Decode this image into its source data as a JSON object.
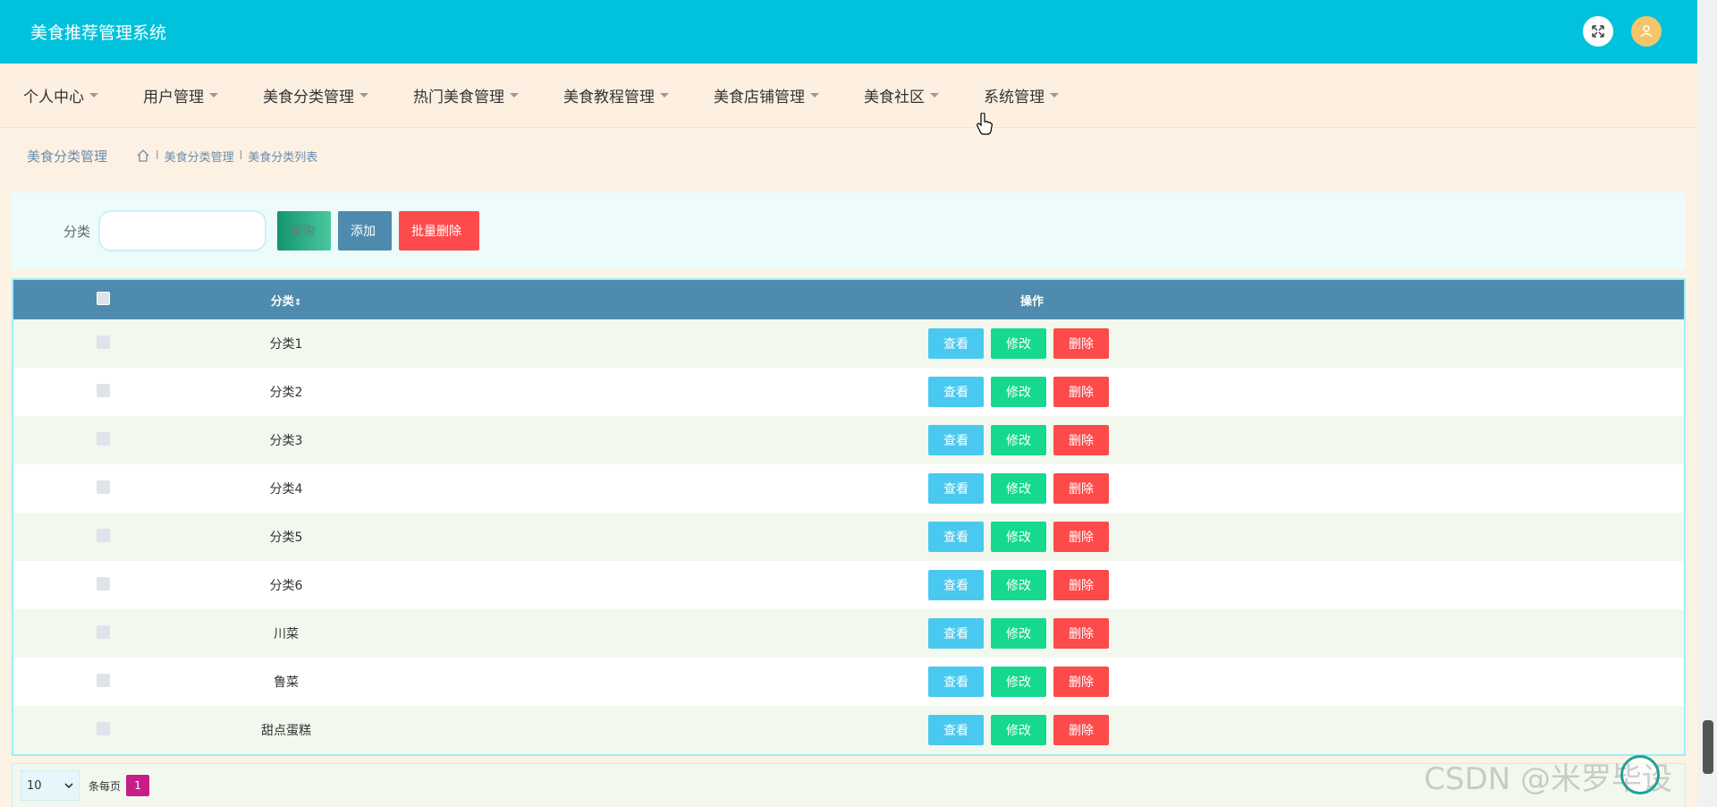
{
  "header": {
    "title": "美食推荐管理系统"
  },
  "nav": {
    "items": [
      {
        "label": "个人中心"
      },
      {
        "label": "用户管理"
      },
      {
        "label": "美食分类管理"
      },
      {
        "label": "热门美食管理"
      },
      {
        "label": "美食教程管理"
      },
      {
        "label": "美食店铺管理"
      },
      {
        "label": "美食社区"
      },
      {
        "label": "系统管理"
      }
    ]
  },
  "breadcrumb": {
    "title": "美食分类管理",
    "path": [
      "美食分类管理",
      "美食分类列表"
    ],
    "separator": "l"
  },
  "search": {
    "label": "分类",
    "value": "",
    "query_label": "查询",
    "add_label": "添加",
    "batch_delete_label": "批量删除"
  },
  "table": {
    "headers": {
      "name": "分类",
      "sort_icon": "⇕",
      "ops": "操作"
    },
    "rows": [
      {
        "name": "分类1"
      },
      {
        "name": "分类2"
      },
      {
        "name": "分类3"
      },
      {
        "name": "分类4"
      },
      {
        "name": "分类5"
      },
      {
        "name": "分类6"
      },
      {
        "name": "川菜"
      },
      {
        "name": "鲁菜"
      },
      {
        "name": "甜点蛋糕"
      }
    ],
    "row_actions": {
      "view": "查看",
      "edit": "修改",
      "delete": "删除"
    }
  },
  "pager": {
    "page_size": "10",
    "per_page_label": "条每页",
    "current_page": "1"
  },
  "watermark": "CSDN @米罗毕设",
  "colors": {
    "header_bg": "#00c2dc",
    "table_head": "#4f8bae",
    "view": "#49c9ef",
    "edit": "#16d98d",
    "delete": "#fd4a4a",
    "page_active": "#c81d89"
  }
}
